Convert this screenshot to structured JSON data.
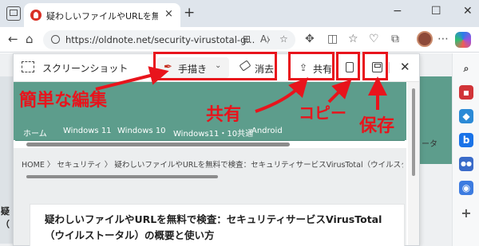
{
  "browser": {
    "tab_title": "疑わしいファイルやURLを無料で検査",
    "tab_close": "×",
    "new_tab": "+",
    "window_controls": [
      "−",
      "☐",
      "✕"
    ],
    "url": "https://oldnote.net/security-virustotal-g...",
    "font_size_button": "A⧽"
  },
  "screenshot_toolbar": {
    "title": "スクリーンショット",
    "draw_label": "手描き",
    "erase_label": "消去",
    "share_label": "共有",
    "close": "✕"
  },
  "captured_page": {
    "nav_items": [
      "ホーム",
      "Windows 11",
      "Windows 10",
      "Windows11・10共通",
      "Android"
    ],
    "breadcrumb": "HOME 〉 セキュリティ 〉 疑わしいファイルやURLを無料で検査：セキュリティサービスVirusTotal（ウイルスター",
    "article_title": "疑わしいファイルやURLを無料で検査：セキュリティサービスVirusTotal（ウイルストータル）の概要と使い方",
    "background_side_text": "ータ",
    "background_left_text": "疑\n（"
  },
  "annotations": {
    "easy_edit": "簡単な編集",
    "share": "共有",
    "copy": "コピー",
    "save": "保存",
    "color": "#e8141c"
  },
  "colors": {
    "site_green": "#5d9d8c",
    "tabbar": "#dfe5ec"
  }
}
